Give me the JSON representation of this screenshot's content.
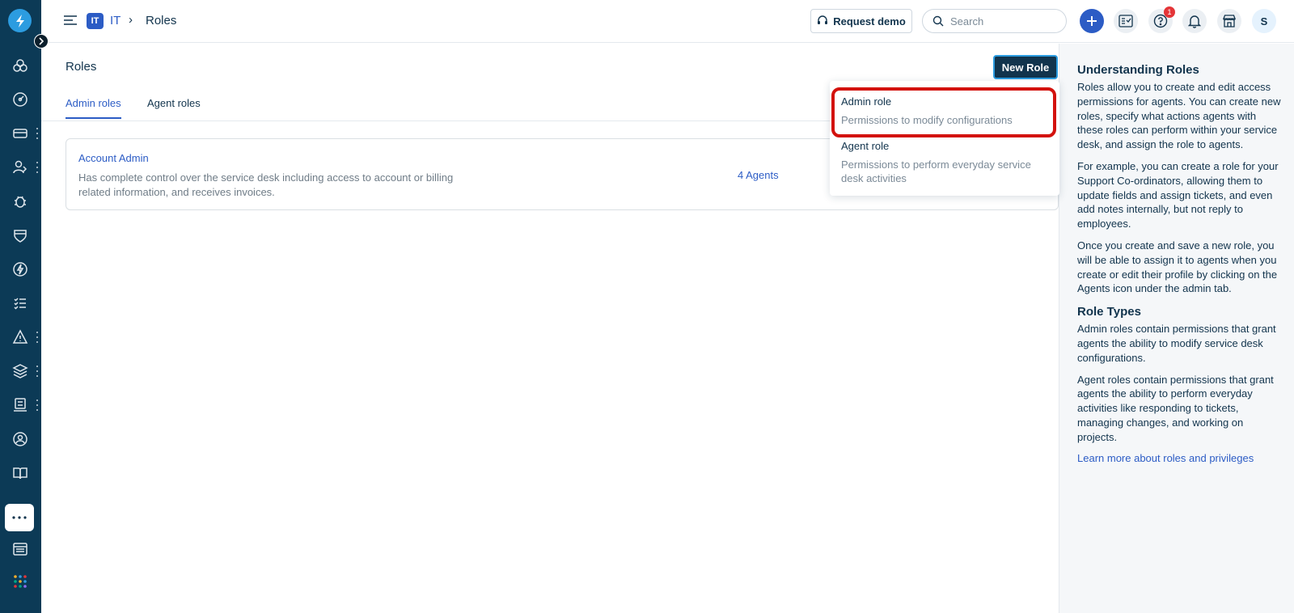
{
  "topbar": {
    "workspace_badge": "IT",
    "workspace_name": "IT",
    "breadcrumb_sep": "›",
    "page": "Roles",
    "request_demo_label": "Request demo",
    "search_placeholder": "Search",
    "notification_count": "1",
    "avatar_initial": "S"
  },
  "main": {
    "title": "Roles",
    "new_role_label": "New Role",
    "tabs": [
      {
        "label": "Admin roles",
        "active": true
      },
      {
        "label": "Agent roles",
        "active": false
      }
    ],
    "roles": [
      {
        "name": "Account Admin",
        "description": "Has complete control over the service desk including access to account or billing related information, and receives invoices.",
        "agents": "4 Agents"
      }
    ]
  },
  "dropdown": {
    "items": [
      {
        "title": "Admin role",
        "description": "Permissions to modify configurations"
      },
      {
        "title": "Agent role",
        "description": "Permissions to perform everyday service desk activities"
      }
    ]
  },
  "help_panel": {
    "heading1": "Understanding Roles",
    "p1": "Roles allow you to create and edit access permissions for agents. You can create new roles, specify what actions agents with these roles can perform within your service desk, and assign the role to agents.",
    "p2": "For example, you can create a role for your Support Co-ordinators, allowing them to update fields and assign tickets, and even add notes internally, but not reply to employees.",
    "p3": "Once you create and save a new role, you will be able to assign it to agents when you create or edit their profile by clicking on the Agents icon under the admin tab.",
    "heading2": "Role Types",
    "p4": "Admin roles contain permissions that grant agents the ability to modify service desk configurations.",
    "p5": "Agent roles contain permissions that grant agents the ability to perform everyday activities like responding to tickets, managing changes, and working on projects.",
    "link": "Learn more about roles and privileges"
  },
  "colors": {
    "nav_bg": "#0c3a56",
    "primary": "#2c5cc5",
    "dark_button": "#12344d",
    "highlight": "#d3120d"
  }
}
